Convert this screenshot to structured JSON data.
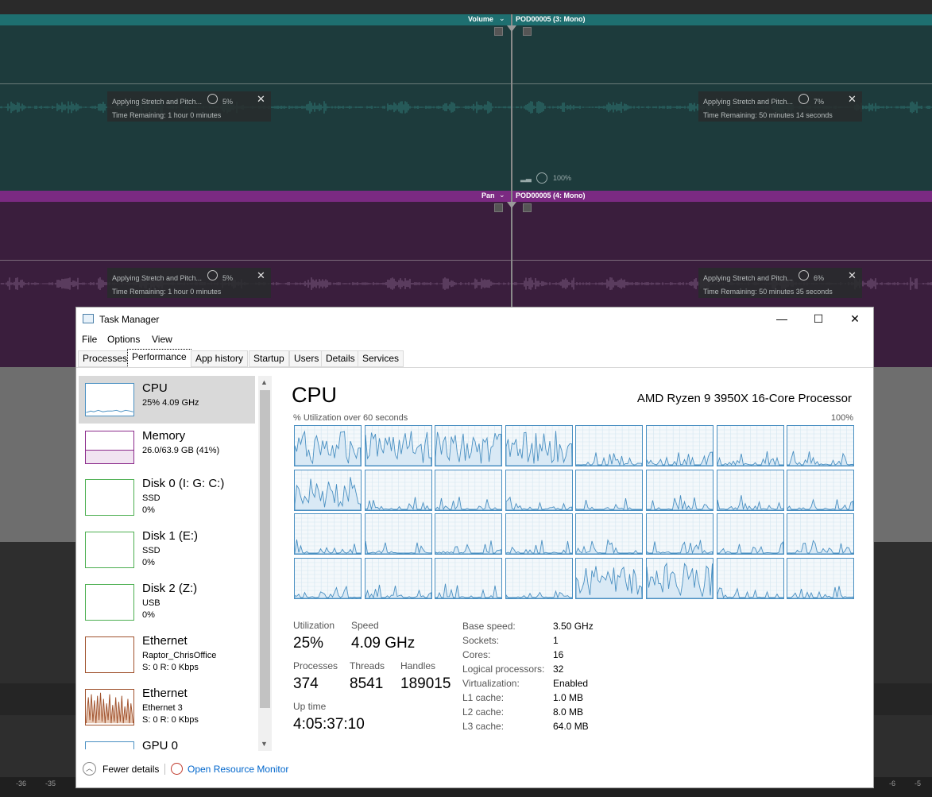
{
  "daw": {
    "track1": {
      "header_label": "Volume",
      "clip_name": "POD00005 (3: Mono)",
      "zoom": "100%",
      "stretch_left": {
        "title": "Applying Stretch and Pitch...",
        "percent": "5%",
        "time": "Time Remaining: 1 hour 0 minutes"
      },
      "stretch_right": {
        "title": "Applying Stretch and Pitch...",
        "percent": "7%",
        "time": "Time Remaining: 50 minutes 14 seconds"
      }
    },
    "track2": {
      "header_label": "Pan",
      "clip_name": "POD00005 (4: Mono)",
      "stretch_left": {
        "title": "Applying Stretch and Pitch...",
        "percent": "5%",
        "time": "Time Remaining: 1 hour 0 minutes"
      },
      "stretch_right": {
        "title": "Applying Stretch and Pitch...",
        "percent": "6%",
        "time": "Time Remaining: 50 minutes 35 seconds"
      }
    },
    "ruler": [
      "-36",
      "-35",
      "-6",
      "-5"
    ],
    "colors": {
      "track1": "#1d3b3c",
      "track1_header": "#1e6f70",
      "track2": "#3a1e3d",
      "track2_header": "#7b2a82"
    }
  },
  "task_manager": {
    "title": "Task Manager",
    "icons": {
      "app": "task-manager-icon",
      "minimize": "minimize-icon",
      "maximize": "maximize-icon",
      "close": "close-icon"
    },
    "window_buttons": {
      "minimize": "—",
      "maximize": "☐",
      "close": "✕"
    },
    "menu": [
      "File",
      "Options",
      "View"
    ],
    "tabs": [
      "Processes",
      "Performance",
      "App history",
      "Startup",
      "Users",
      "Details",
      "Services"
    ],
    "active_tab": "Performance",
    "perf_items": [
      {
        "name": "CPU",
        "lines": [
          "25% 4.09 GHz"
        ]
      },
      {
        "name": "Memory",
        "lines": [
          "26.0/63.9 GB (41%)"
        ]
      },
      {
        "name": "Disk 0 (I: G: C:)",
        "lines": [
          "SSD",
          "0%"
        ]
      },
      {
        "name": "Disk 1 (E:)",
        "lines": [
          "SSD",
          "0%"
        ]
      },
      {
        "name": "Disk 2 (Z:)",
        "lines": [
          "USB",
          "0%"
        ]
      },
      {
        "name": "Ethernet",
        "lines": [
          "Raptor_ChrisOffice",
          "S: 0 R: 0 Kbps"
        ]
      },
      {
        "name": "Ethernet",
        "lines": [
          "Ethernet 3",
          "S: 0 R: 0 Kbps"
        ]
      },
      {
        "name": "GPU 0",
        "lines": []
      }
    ],
    "cpu": {
      "title": "CPU",
      "model": "AMD Ryzen 9 3950X 16-Core Processor",
      "graph_label": "% Utilization over 60 seconds",
      "graph_max": "100%",
      "core_count_shown": 32,
      "stats": {
        "utilization_label": "Utilization",
        "utilization": "25%",
        "speed_label": "Speed",
        "speed": "4.09 GHz",
        "processes_label": "Processes",
        "processes": "374",
        "threads_label": "Threads",
        "threads": "8541",
        "handles_label": "Handles",
        "handles": "189015",
        "uptime_label": "Up time",
        "uptime": "4:05:37:10"
      },
      "specs": [
        {
          "label": "Base speed:",
          "value": "3.50 GHz"
        },
        {
          "label": "Sockets:",
          "value": "1"
        },
        {
          "label": "Cores:",
          "value": "16"
        },
        {
          "label": "Logical processors:",
          "value": "32"
        },
        {
          "label": "Virtualization:",
          "value": "Enabled"
        },
        {
          "label": "L1 cache:",
          "value": "1.0 MB"
        },
        {
          "label": "L2 cache:",
          "value": "8.0 MB"
        },
        {
          "label": "L3 cache:",
          "value": "64.0 MB"
        }
      ]
    },
    "footer": {
      "fewer_details": "Fewer details",
      "resource_monitor": "Open Resource Monitor"
    },
    "colors": {
      "cpu_line": "#4a90c2",
      "memory": "#8b2a8b",
      "disk": "#4caf50",
      "ethernet": "#a0522d",
      "selected": "#d9d9d9"
    }
  }
}
